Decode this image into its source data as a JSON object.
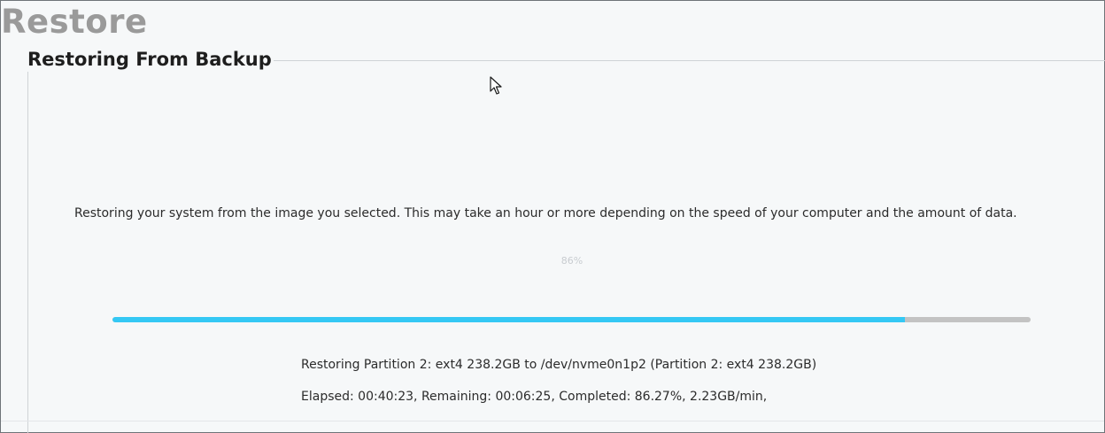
{
  "page": {
    "title": "Restore"
  },
  "section": {
    "title": "Restoring From Backup"
  },
  "description": "Restoring your system from the image you selected.  This may take an hour or more depending on the speed of your computer and the amount of data.",
  "progress": {
    "label": "86%",
    "value": 0.8627,
    "fill_color": "#34c8f4",
    "track_color": "#c3c3c3"
  },
  "status": {
    "partition_line": "Restoring Partition 2: ext4 238.2GB to /dev/nvme0n1p2 (Partition 2: ext4 238.2GB)",
    "stats_line": "Elapsed: 00:40:23, Remaining: 00:06:25, Completed:  86.27%,   2.23GB/min,"
  },
  "icons": {
    "cursor": "mouse-pointer-icon"
  }
}
